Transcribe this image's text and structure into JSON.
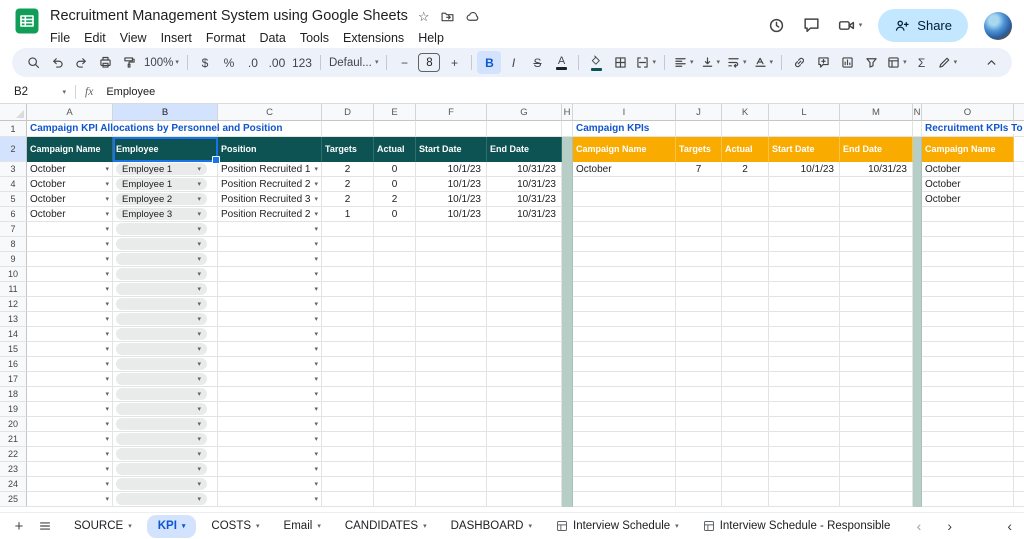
{
  "app": {
    "product": "Google Sheets",
    "doc_title": "Recruitment Management System using Google Sheets",
    "menu": [
      "File",
      "Edit",
      "View",
      "Insert",
      "Format",
      "Data",
      "Tools",
      "Extensions",
      "Help"
    ],
    "share_label": "Share"
  },
  "toolbar": {
    "zoom": "100%",
    "currency": "$",
    "percent": "%",
    "decrease_decimal": ".0",
    "increase_decimal": ".00",
    "more_formats": "123",
    "font": "Defaul...",
    "minus": "−",
    "font_size": "8",
    "plus": "+",
    "bold": "B",
    "italic": "I",
    "strikethrough": "S",
    "text_color": "A",
    "sigma": "Σ"
  },
  "formula_bar": {
    "cell_reference": "B2",
    "fx_label": "fx",
    "value": "Employee"
  },
  "colors": {
    "header_teal": "#0e5353",
    "header_orange": "#f9ab00",
    "separator_green": "#b6cec6",
    "title_blue": "#1155cc",
    "selection_blue": "#1a73e8",
    "active_tab_bg": "#d3e3fd",
    "active_tab_text": "#0b57d0",
    "share_bg": "#c2e7ff"
  },
  "grid": {
    "columns": [
      "A",
      "B",
      "C",
      "D",
      "E",
      "F",
      "G",
      "H",
      "I",
      "J",
      "K",
      "L",
      "M",
      "N",
      "O",
      ""
    ],
    "row_count": 25,
    "separator_columns": [
      "H",
      "N"
    ],
    "selection": {
      "cell": "B2",
      "column": "B",
      "row": 2
    },
    "empty_dropdown_rows": {
      "from": 7,
      "to": 25,
      "styles": {
        "A": "dd-empty",
        "B": "chip-empty",
        "C": "dd-empty"
      }
    },
    "cells": {
      "A1": {
        "t": "Campaign KPI Allocations by Personnel and Position",
        "s": "title"
      },
      "I1": {
        "t": "Campaign KPIs",
        "s": "title"
      },
      "O1": {
        "t": "Recruitment KPIs To",
        "s": "title"
      },
      "A2": {
        "t": "Campaign Name",
        "s": "teal"
      },
      "B2": {
        "t": "Employee",
        "s": "teal"
      },
      "C2": {
        "t": "Position",
        "s": "teal"
      },
      "D2": {
        "t": "Targets",
        "s": "teal"
      },
      "E2": {
        "t": "Actual",
        "s": "teal"
      },
      "F2": {
        "t": "Start Date",
        "s": "teal"
      },
      "G2": {
        "t": "End Date",
        "s": "teal"
      },
      "I2": {
        "t": "Campaign Name",
        "s": "orange"
      },
      "J2": {
        "t": "Targets",
        "s": "orange"
      },
      "K2": {
        "t": "Actual",
        "s": "orange"
      },
      "L2": {
        "t": "Start Date",
        "s": "orange"
      },
      "M2": {
        "t": "End Date",
        "s": "orange"
      },
      "O2": {
        "t": "Campaign Name",
        "s": "orange"
      },
      "A3": {
        "t": "October",
        "s": "dd"
      },
      "A4": {
        "t": "October",
        "s": "dd"
      },
      "A5": {
        "t": "October",
        "s": "dd"
      },
      "A6": {
        "t": "October",
        "s": "dd"
      },
      "B3": {
        "t": "Employee 1",
        "s": "chip"
      },
      "B4": {
        "t": "Employee 1",
        "s": "chip"
      },
      "B5": {
        "t": "Employee 2",
        "s": "chip"
      },
      "B6": {
        "t": "Employee 3",
        "s": "chip"
      },
      "C3": {
        "t": "Position Recruited 1",
        "s": "dd"
      },
      "C4": {
        "t": "Position Recruited 2",
        "s": "dd"
      },
      "C5": {
        "t": "Position Recruited 3",
        "s": "dd"
      },
      "C6": {
        "t": "Position Recruited 2",
        "s": "dd"
      },
      "D3": {
        "t": "2",
        "s": "num"
      },
      "D4": {
        "t": "2",
        "s": "num"
      },
      "D5": {
        "t": "2",
        "s": "num"
      },
      "D6": {
        "t": "1",
        "s": "num"
      },
      "E3": {
        "t": "0",
        "s": "num"
      },
      "E4": {
        "t": "0",
        "s": "num"
      },
      "E5": {
        "t": "2",
        "s": "num"
      },
      "E6": {
        "t": "0",
        "s": "num"
      },
      "F3": {
        "t": "10/1/23",
        "s": "date"
      },
      "F4": {
        "t": "10/1/23",
        "s": "date"
      },
      "F5": {
        "t": "10/1/23",
        "s": "date"
      },
      "F6": {
        "t": "10/1/23",
        "s": "date"
      },
      "G3": {
        "t": "10/31/23",
        "s": "date"
      },
      "G4": {
        "t": "10/31/23",
        "s": "date"
      },
      "G5": {
        "t": "10/31/23",
        "s": "date"
      },
      "G6": {
        "t": "10/31/23",
        "s": "date"
      },
      "I3": {
        "t": "October",
        "s": "text"
      },
      "J3": {
        "t": "7",
        "s": "num"
      },
      "K3": {
        "t": "2",
        "s": "num"
      },
      "L3": {
        "t": "10/1/23",
        "s": "date"
      },
      "M3": {
        "t": "10/31/23",
        "s": "date"
      },
      "O3": {
        "t": "October",
        "s": "text"
      },
      "O4": {
        "t": "October",
        "s": "text"
      },
      "O5": {
        "t": "October",
        "s": "text"
      }
    }
  },
  "sheet_tabs": {
    "tabs": [
      {
        "label": "SOURCE",
        "caret": true
      },
      {
        "label": "KPI",
        "active": true,
        "caret": true
      },
      {
        "label": "COSTS",
        "caret": true
      },
      {
        "label": "Email",
        "caret": true
      },
      {
        "label": "CANDIDATES",
        "caret": true
      },
      {
        "label": "DASHBOARD",
        "caret": true
      },
      {
        "label": "Interview Schedule",
        "icon": "sheet-grid",
        "caret": true
      },
      {
        "label": "Interview Schedule - Responsible",
        "icon": "sheet-grid"
      }
    ]
  }
}
